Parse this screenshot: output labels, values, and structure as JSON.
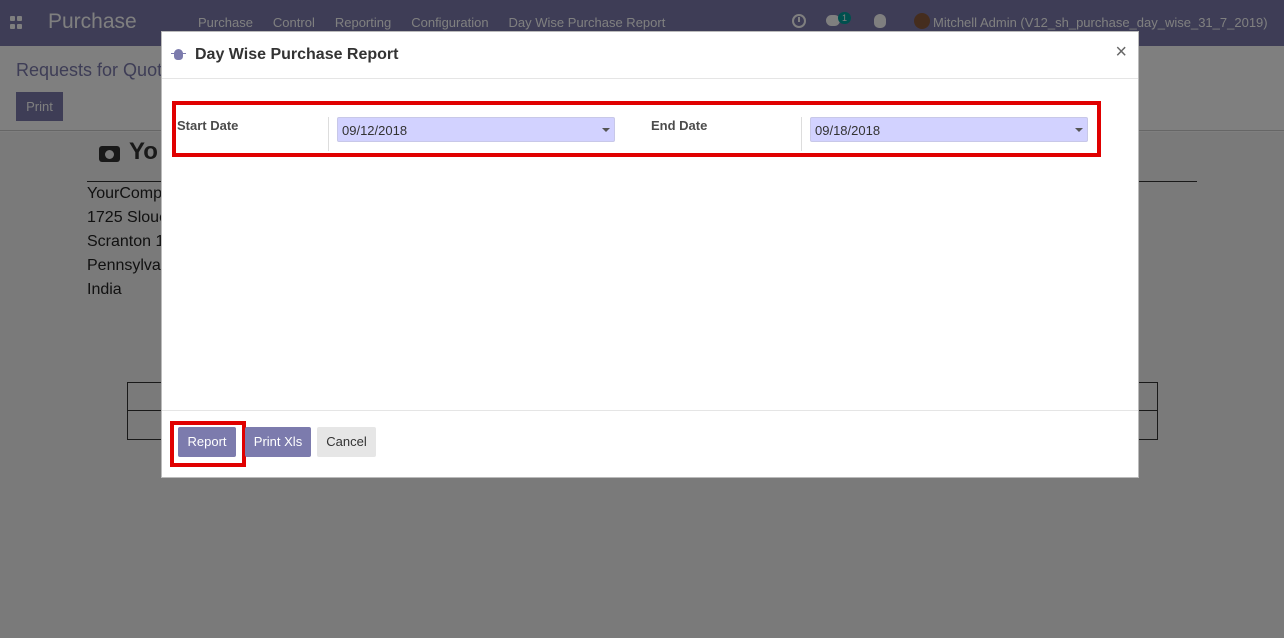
{
  "navbar": {
    "app_title": "Purchase",
    "menu": [
      "Purchase",
      "Control",
      "Reporting",
      "Configuration",
      "Day Wise Purchase Report"
    ],
    "chat_badge": "1",
    "user": "Mitchell Admin (V12_sh_purchase_day_wise_31_7_2019)"
  },
  "page": {
    "breadcrumb": "Requests for Quot",
    "print_label": "Print",
    "company_initial": "Yo",
    "address": [
      "YourComp",
      "1725 Slouc",
      "Scranton 1",
      "Pennsylva",
      "India"
    ]
  },
  "modal": {
    "title": "Day Wise Purchase Report",
    "close": "×",
    "start_label": "Start Date",
    "start_value": "09/12/2018",
    "end_label": "End Date",
    "end_value": "09/18/2018",
    "buttons": {
      "report": "Report",
      "print_xls": "Print Xls",
      "cancel": "Cancel"
    }
  },
  "colors": {
    "brand": "#7c7bad",
    "highlight": "#e00000",
    "date_field": "#d2d2ff"
  }
}
